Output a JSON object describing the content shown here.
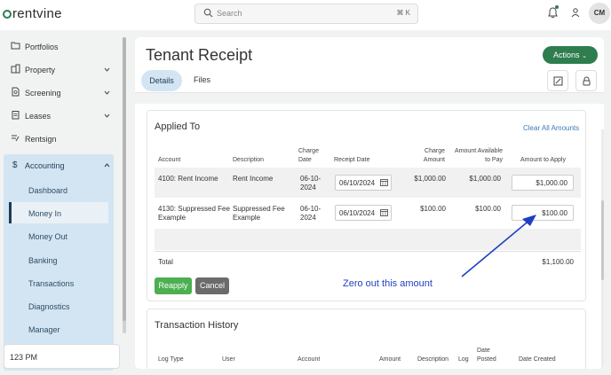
{
  "app": {
    "logo_text": "rentvine",
    "search_placeholder": "Search",
    "search_shortcut": "⌘ K",
    "avatar_initials": "CM",
    "brand_color": "#2e7d4f"
  },
  "sidebar": {
    "items": [
      {
        "label": "Portfolios",
        "icon": "folder-icon"
      },
      {
        "label": "Property",
        "icon": "building-icon"
      },
      {
        "label": "Screening",
        "icon": "document-icon"
      },
      {
        "label": "Leases",
        "icon": "clipboard-icon"
      },
      {
        "label": "Rentsign",
        "icon": "signature-icon"
      },
      {
        "label": "Accounting",
        "icon": "dollar-icon"
      }
    ],
    "accounting_sub": [
      "Dashboard",
      "Money In",
      "Money Out",
      "Banking",
      "Transactions",
      "Diagnostics",
      "Manager"
    ],
    "active_sub": "Money In",
    "bottom_text": "123 PM"
  },
  "page": {
    "title": "Tenant Receipt",
    "actions_label": "Actions",
    "tabs": [
      "Details",
      "Files"
    ]
  },
  "applied": {
    "title": "Applied To",
    "clear_all": "Clear All Amounts",
    "headers": {
      "account": "Account",
      "description": "Description",
      "charge_date_1": "Charge",
      "charge_date_2": "Date",
      "receipt_date": "Receipt Date",
      "charge_amount_1": "Charge",
      "charge_amount_2": "Amount",
      "avail_1": "Amount Available",
      "avail_2": "to Pay",
      "apply": "Amount to Apply"
    },
    "rows": [
      {
        "account_1": "4100: Rent Income",
        "account_2": "",
        "desc_1": "Rent Income",
        "desc_2": "",
        "date_1": "06-10-",
        "date_2": "2024",
        "receipt": "06/10/2024",
        "charge": "$1,000.00",
        "available": "$1,000.00",
        "apply": "$1,000.00"
      },
      {
        "account_1": "4130: Suppressed Fee",
        "account_2": "Example",
        "desc_1": "Suppressed Fee",
        "desc_2": "Example",
        "date_1": "06-10-",
        "date_2": "2024",
        "receipt": "06/10/2024",
        "charge": "$100.00",
        "available": "$100.00",
        "apply": "$100.00"
      }
    ],
    "total_label": "Total",
    "total_value": "$1,100.00",
    "reapply": "Reapply",
    "cancel": "Cancel"
  },
  "annotation": "Zero out this amount",
  "history": {
    "title": "Transaction History",
    "headers": [
      "Log Type",
      "User",
      "Account",
      "Amount",
      "Description",
      "Log",
      "Date",
      "Posted",
      "Date Created"
    ]
  }
}
